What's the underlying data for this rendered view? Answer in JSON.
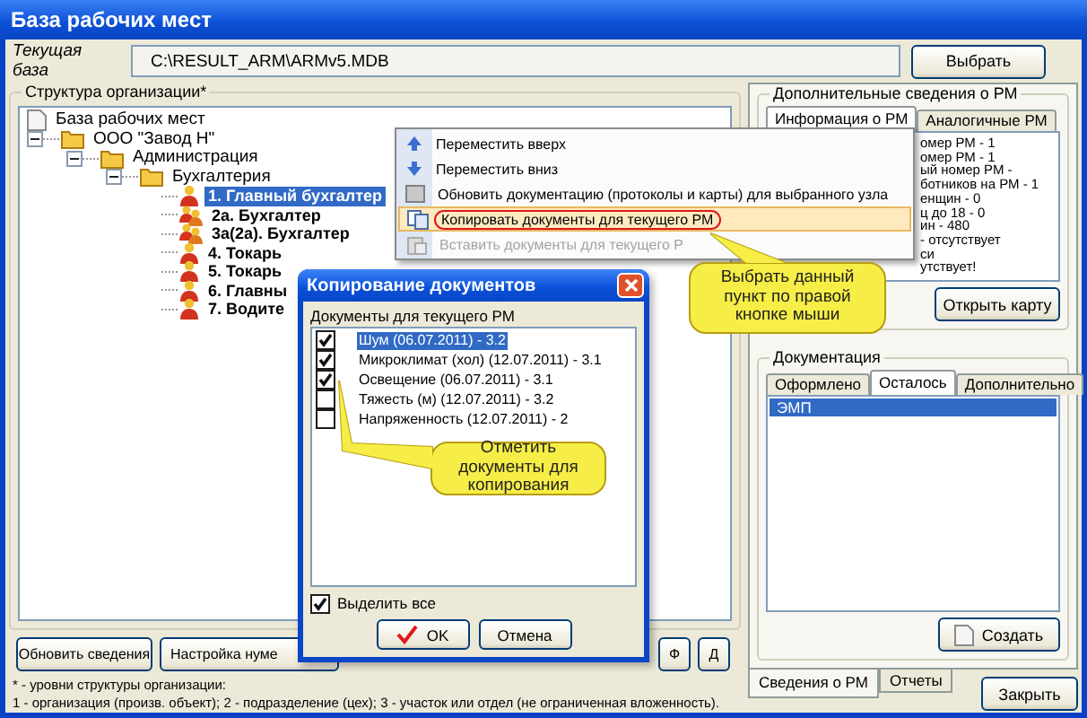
{
  "window": {
    "title": "База рабочих мест"
  },
  "database": {
    "label": "Текущая база",
    "value": "C:\\RESULT_ARM\\ARMv5.MDB",
    "button": "Выбрать"
  },
  "structure": {
    "title": "Структура организации*",
    "tree": [
      {
        "label": "База рабочих мест",
        "kind": "database",
        "selected": false,
        "children": [
          {
            "label": "ООО \"Завод Н\"",
            "kind": "folder",
            "selected": false,
            "expanded": true,
            "children": [
              {
                "label": "Администрация",
                "kind": "folder",
                "selected": false,
                "expanded": true,
                "children": [
                  {
                    "label": "Бухгалтерия",
                    "kind": "folder",
                    "selected": false,
                    "expanded": true,
                    "children": [
                      {
                        "label": "1. Главный бухгалтер",
                        "kind": "workplace",
                        "selected": true
                      },
                      {
                        "label": "2а. Бухгалтер",
                        "kind": "workplace-group",
                        "selected": false
                      },
                      {
                        "label": "3а(2а). Бухгалтер",
                        "kind": "workplace-group",
                        "selected": false
                      },
                      {
                        "label": "4. Токарь",
                        "kind": "workplace",
                        "selected": false
                      },
                      {
                        "label": "5. Токарь",
                        "kind": "workplace",
                        "selected": false
                      },
                      {
                        "label": "6. Главны",
                        "kind": "workplace",
                        "selected": false
                      },
                      {
                        "label": "7. Водите",
                        "kind": "workplace",
                        "selected": false
                      }
                    ]
                  }
                ]
              }
            ]
          }
        ]
      }
    ]
  },
  "left_buttons": [
    "Обновить сведения",
    "Настройка нуме",
    "Ф",
    "Д"
  ],
  "legend": [
    "* - уровни структуры организации:",
    "1 - организация (произв. объект); 2 - подразделение (цех); 3 - участок или отдел (не ограниченная вложенность)."
  ],
  "info_panel": {
    "title": "Дополнительные сведения о РМ",
    "tabs": [
      {
        "label": "Информация о РМ",
        "selected": true
      },
      {
        "label": "Аналогичные РМ",
        "selected": false
      }
    ],
    "lines": [
      "омер РМ - 1",
      "омер РМ - 1",
      "ый номер РМ -",
      "ботников на РМ - 1",
      "енщин - 0",
      "ц до 18 - 0",
      "ин - 480",
      "- отсутствует",
      "си",
      "утствует!"
    ],
    "button": "Открыть карту"
  },
  "docs_panel": {
    "title": "Документация",
    "tabs": [
      {
        "label": "Оформлено",
        "selected": false
      },
      {
        "label": "Осталось",
        "selected": true
      },
      {
        "label": "Дополнительно",
        "selected": false
      }
    ],
    "items": [
      {
        "label": "ЭМП",
        "selected": true
      }
    ],
    "button": "Создать"
  },
  "bottom_tabs": [
    {
      "label": "Сведения о РМ",
      "selected": true
    },
    {
      "label": "Отчеты",
      "selected": false
    }
  ],
  "close_button": "Закрыть",
  "context_menu": {
    "items": [
      {
        "label": "Переместить вверх",
        "selected": false,
        "disabled": false
      },
      {
        "label": "Переместить вниз",
        "selected": false,
        "disabled": false
      },
      {
        "label": "Обновить документацию (протоколы и карты) для выбранного узла",
        "selected": false,
        "disabled": false
      },
      {
        "label": "Копировать документы для текущего РМ",
        "selected": true,
        "disabled": false
      },
      {
        "label": "Вставить документы для текущего Р",
        "selected": false,
        "disabled": true
      }
    ]
  },
  "dialog": {
    "title": "Копирование документов",
    "list_title": "Документы для текущего РМ",
    "items": [
      {
        "label": "Шум (06.07.2011) - 3.2",
        "checked": true,
        "selected": true
      },
      {
        "label": "Микроклимат (хол) (12.07.2011) - 3.1",
        "checked": true,
        "selected": false
      },
      {
        "label": "Освещение (06.07.2011) - 3.1",
        "checked": true,
        "selected": false
      },
      {
        "label": "Тяжесть (м) (12.07.2011) - 3.2",
        "checked": false,
        "selected": false
      },
      {
        "label": "Напряженность (12.07.2011) - 2",
        "checked": false,
        "selected": false
      }
    ],
    "select_all": {
      "label": "Выделить все",
      "checked": true
    },
    "buttons": [
      "OK",
      "Отмена"
    ]
  },
  "callouts": [
    {
      "text": "Выбрать данный пункт по правой кнопке мыши"
    },
    {
      "text": "Отметить документы для копирования"
    }
  ]
}
